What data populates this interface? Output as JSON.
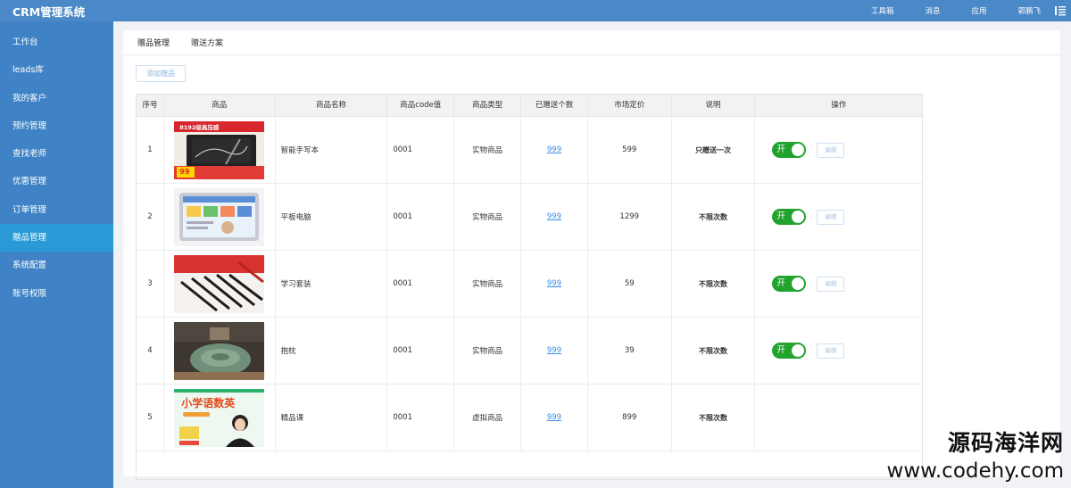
{
  "app": {
    "title": "CRM管理系统"
  },
  "topnav": {
    "toolbox": "工具箱",
    "messages": "消息",
    "apps": "应用",
    "user": "郭鹏飞"
  },
  "sidebar": {
    "items": [
      {
        "label": "工作台"
      },
      {
        "label": "leads库"
      },
      {
        "label": "我的客户"
      },
      {
        "label": "预约管理"
      },
      {
        "label": "查找老师"
      },
      {
        "label": "优惠管理"
      },
      {
        "label": "订单管理"
      },
      {
        "label": "赠品管理",
        "active": true
      },
      {
        "label": "系统配置"
      },
      {
        "label": "账号权限"
      }
    ]
  },
  "tabs": [
    {
      "label": "赠品管理",
      "active": true
    },
    {
      "label": "赠送方案"
    }
  ],
  "toolbar": {
    "add_label": "添加赠品"
  },
  "table": {
    "headers": [
      "序号",
      "商品",
      "商品名称",
      "商品code值",
      "商品类型",
      "已赠送个数",
      "市场定价",
      "说明",
      "操作"
    ],
    "rows": [
      {
        "index": "1",
        "name": "智能手写本",
        "code": "0001",
        "type": "实物商品",
        "sent": "999",
        "price": "599",
        "note": "只赠送一次",
        "toggle": "开",
        "edit": "编辑",
        "image": "smart-notebook-image"
      },
      {
        "index": "2",
        "name": "平板电脑",
        "code": "0001",
        "type": "实物商品",
        "sent": "999",
        "price": "1299",
        "note": "不限次数",
        "toggle": "开",
        "edit": "编辑",
        "image": "tablet-image"
      },
      {
        "index": "3",
        "name": "学习套装",
        "code": "0001",
        "type": "实物商品",
        "sent": "999",
        "price": "59",
        "note": "不限次数",
        "toggle": "开",
        "edit": "编辑",
        "image": "pen-set-image"
      },
      {
        "index": "4",
        "name": "抱枕",
        "code": "0001",
        "type": "实物商品",
        "sent": "999",
        "price": "39",
        "note": "不限次数",
        "toggle": "开",
        "edit": "编辑",
        "image": "pillow-image"
      },
      {
        "index": "5",
        "name": "精品课",
        "code": "0001",
        "type": "虚拟商品",
        "sent": "999",
        "price": "899",
        "note": "不限次数",
        "toggle": "",
        "edit": "",
        "image": "course-image"
      }
    ]
  },
  "thumbs": {
    "notebook_headline": "8192级高压感",
    "notebook_badge": "99",
    "course_title": "小学语数英"
  },
  "watermark": {
    "cn": "源码海洋网",
    "url": "www.codehy.com"
  },
  "colors": {
    "topbar": "#4a88c7",
    "sidebar": "#3f83c6",
    "sidebar_active": "#2a9ad6",
    "toggle_on": "#21a32e",
    "link": "#3a8ee6"
  }
}
